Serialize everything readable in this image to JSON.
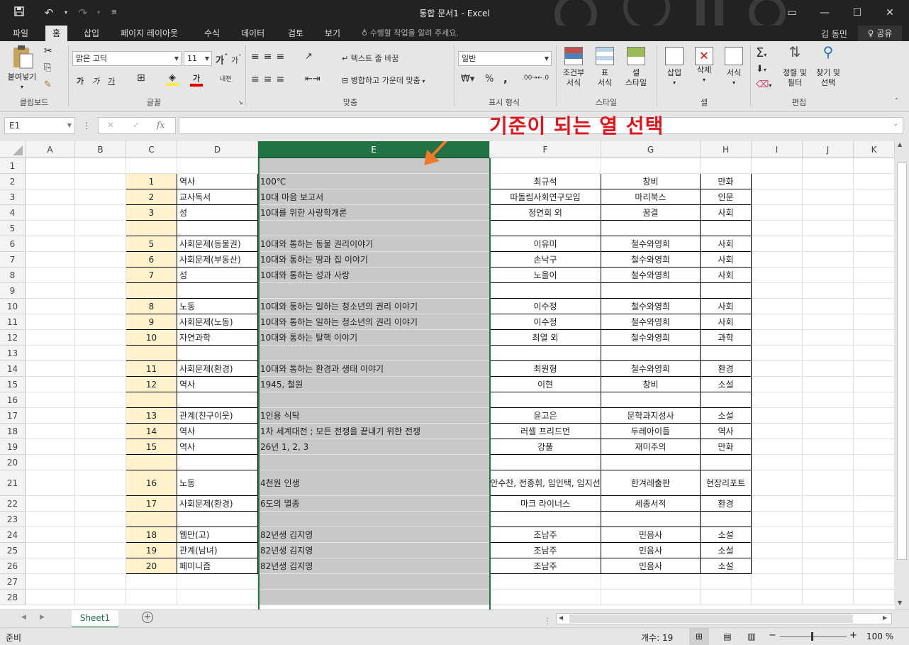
{
  "window": {
    "title": "통합 문서1 - Excel",
    "user": "김 동민",
    "share": "공유"
  },
  "menu": {
    "items": [
      "파일",
      "홈",
      "삽입",
      "페이지 레이아웃",
      "수식",
      "데이터",
      "검토",
      "보기"
    ],
    "active": "홈",
    "tellme": "수행할 작업을 알려 주세요."
  },
  "ribbon": {
    "clipboard": {
      "paste": "붙여넣기",
      "group": "클립보드"
    },
    "font": {
      "name": "맑은 고딕",
      "size": "11",
      "bold": "가",
      "italic": "가",
      "underline": "가",
      "color_btn": "가",
      "phonetic": "내천",
      "group": "글꼴"
    },
    "align": {
      "wrap": "텍스트 줄 바꿈",
      "merge": "병합하고 가운데 맞춤",
      "group": "맞춤"
    },
    "number": {
      "format": "일반",
      "percent": "%",
      "comma": ",",
      "group": "표시 형식"
    },
    "styles": {
      "cond": [
        "조건부",
        "서식"
      ],
      "table": [
        "표",
        "서식"
      ],
      "cell": [
        "셀",
        "스타일"
      ],
      "group": "스타일"
    },
    "cells": {
      "insert": "삽입",
      "delete": "삭제",
      "format": "서식",
      "group": "셀"
    },
    "edit": {
      "sort": [
        "정렬 및",
        "필터"
      ],
      "find": [
        "찾기 및",
        "선택"
      ],
      "group": "편집"
    }
  },
  "formula": {
    "namebox": "E1",
    "fx": "fx",
    "value": ""
  },
  "annotation": "기준이 되는 열 선택",
  "columns": [
    "A",
    "B",
    "C",
    "D",
    "E",
    "F",
    "G",
    "H",
    "I",
    "J",
    "K"
  ],
  "selected_column": "E",
  "rows": [
    {
      "r": "1",
      "c": "",
      "d": "",
      "e": "",
      "f": "",
      "g": "",
      "h": ""
    },
    {
      "r": "2",
      "c": "1",
      "d": "역사",
      "e": "100℃",
      "f": "최규석",
      "g": "창비",
      "h": "만화"
    },
    {
      "r": "3",
      "c": "2",
      "d": "교사독서",
      "e": "10대 마음 보고서",
      "f": "따돌림사회연구모임",
      "g": "마리북스",
      "h": "인문"
    },
    {
      "r": "4",
      "c": "3",
      "d": "성",
      "e": "10대를 위한 사랑학개론",
      "f": "정연희 외",
      "g": "꿈결",
      "h": "사회"
    },
    {
      "r": "5",
      "c": "",
      "d": "",
      "e": "",
      "f": "",
      "g": "",
      "h": ""
    },
    {
      "r": "6",
      "c": "5",
      "d": "사회문제(동물권)",
      "e": "10대와 통하는 동물 권리이야기",
      "f": "이유미",
      "g": "철수와영희",
      "h": "사회"
    },
    {
      "r": "7",
      "c": "6",
      "d": "사회문제(부동산)",
      "e": "10대와 통하는 땅과 집 이야기",
      "f": "손낙구",
      "g": "철수와영희",
      "h": "사회"
    },
    {
      "r": "8",
      "c": "7",
      "d": "성",
      "e": "10대와 통하는 성과 사랑",
      "f": "노을이",
      "g": "철수와영희",
      "h": "사회"
    },
    {
      "r": "9",
      "c": "",
      "d": "",
      "e": "",
      "f": "",
      "g": "",
      "h": ""
    },
    {
      "r": "10",
      "c": "8",
      "d": "노동",
      "e": "10대와 통하는 일하는 청소년의 권리 이야기",
      "f": "이수정",
      "g": "철수와영희",
      "h": "사회"
    },
    {
      "r": "11",
      "c": "9",
      "d": "사회문제(노동)",
      "e": "10대와 통하는 일하는 청소년의 권리 이야기",
      "f": "이수정",
      "g": "철수와영희",
      "h": "사회"
    },
    {
      "r": "12",
      "c": "10",
      "d": "자연과학",
      "e": "10대와 통하는 탈핵 이야기",
      "f": "최열 외",
      "g": "철수와영희",
      "h": "과학"
    },
    {
      "r": "13",
      "c": "",
      "d": "",
      "e": "",
      "f": "",
      "g": "",
      "h": ""
    },
    {
      "r": "14",
      "c": "11",
      "d": "사회문제(환경)",
      "e": "10대와 통하는 환경과 생태 이야기",
      "f": "최원형",
      "g": "철수와영희",
      "h": "환경"
    },
    {
      "r": "15",
      "c": "12",
      "d": "역사",
      "e": "1945, 철원",
      "f": "이현",
      "g": "창비",
      "h": "소설"
    },
    {
      "r": "16",
      "c": "",
      "d": "",
      "e": "",
      "f": "",
      "g": "",
      "h": ""
    },
    {
      "r": "17",
      "c": "13",
      "d": "관계(친구이웃)",
      "e": "1인용 식탁",
      "f": "윤고은",
      "g": "문학과지성사",
      "h": "소설"
    },
    {
      "r": "18",
      "c": "14",
      "d": "역사",
      "e": "1차 세계대전 ; 모든 전쟁을 끝내기 위한 전쟁",
      "f": "러셀 프리드먼",
      "g": "두레아이들",
      "h": "역사"
    },
    {
      "r": "19",
      "c": "15",
      "d": "역사",
      "e": "26년 1, 2, 3",
      "f": "강풀",
      "g": "재미주의",
      "h": "만화"
    },
    {
      "r": "20",
      "c": "",
      "d": "",
      "e": "",
      "f": "",
      "g": "",
      "h": ""
    },
    {
      "r": "21",
      "c": "16",
      "d": "노동",
      "e": "4천원 인생",
      "f": "안수찬, 전종휘, 임인택, 임지선",
      "g": "한겨레출판",
      "h": "현장리포트"
    },
    {
      "r": "22",
      "c": "17",
      "d": "사회문제(환경)",
      "e": "6도의 멸종",
      "f": "마크 라이너스",
      "g": "세종서적",
      "h": "환경"
    },
    {
      "r": "23",
      "c": "",
      "d": "",
      "e": "",
      "f": "",
      "g": "",
      "h": ""
    },
    {
      "r": "24",
      "c": "18",
      "d": "웹만(고)",
      "e": "82년생 김지영",
      "f": "조남주",
      "g": "민음사",
      "h": "소설"
    },
    {
      "r": "25",
      "c": "19",
      "d": "관계(남녀)",
      "e": "82년생 김지영",
      "f": "조남주",
      "g": "민음사",
      "h": "소설"
    },
    {
      "r": "26",
      "c": "20",
      "d": "페미니즘",
      "e": "82년생 김지영",
      "f": "조남주",
      "g": "민음사",
      "h": "소설"
    },
    {
      "r": "27",
      "c": "",
      "d": "",
      "e": "",
      "f": "",
      "g": "",
      "h": ""
    },
    {
      "r": "28",
      "c": "",
      "d": "",
      "e": "",
      "f": "",
      "g": "",
      "h": ""
    }
  ],
  "tabs": {
    "sheet": "Sheet1"
  },
  "status": {
    "ready": "준비",
    "count": "개수: 19",
    "zoom": "100 %"
  },
  "colors": {
    "accent": "#217346",
    "selected_col": "#c8c8c8",
    "num_fill": "#fff2cc",
    "annotation": "#e0141d"
  }
}
